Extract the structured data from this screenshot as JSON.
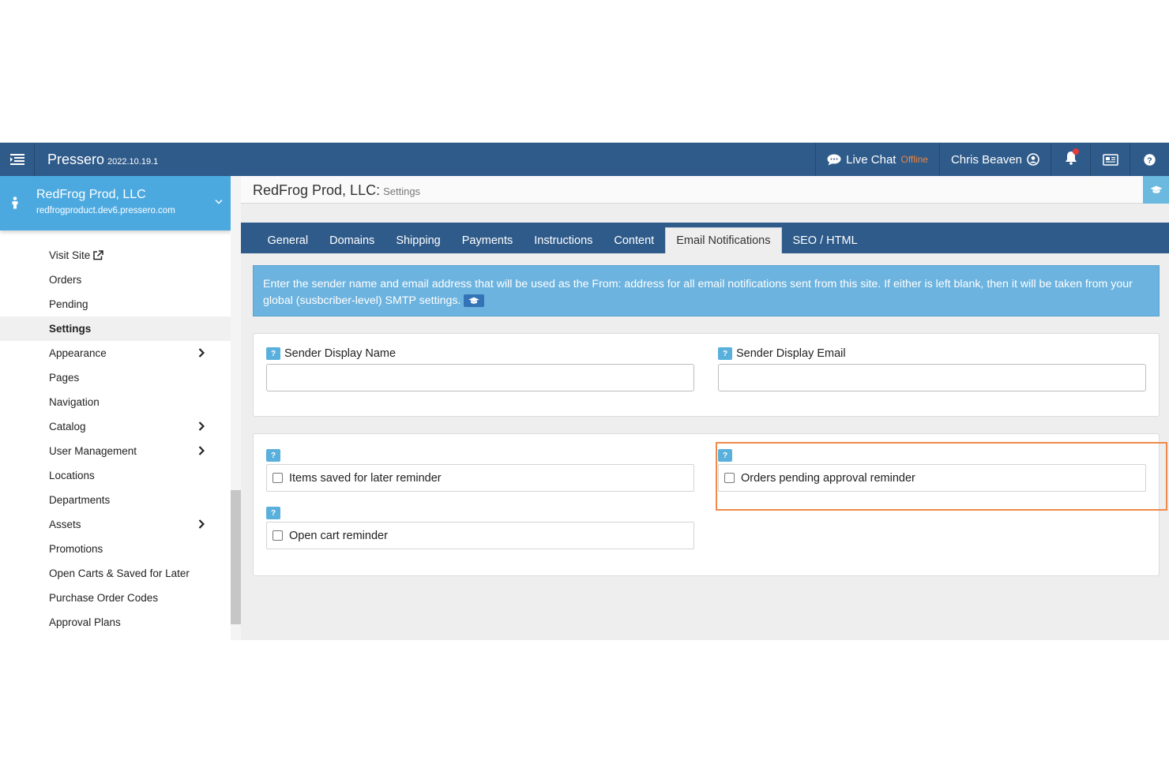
{
  "topbar": {
    "brand": "Pressero",
    "version": "2022.10.19.1",
    "live_chat_label": "Live Chat",
    "live_chat_status": "Offline",
    "user_name": "Chris Beaven"
  },
  "site": {
    "name": "RedFrog Prod, LLC",
    "url": "redfrogproduct.dev6.pressero.com"
  },
  "sidebar": {
    "items": [
      {
        "label": "Visit Site",
        "external": true
      },
      {
        "label": "Orders"
      },
      {
        "label": "Pending"
      },
      {
        "label": "Settings",
        "active": true
      },
      {
        "label": "Appearance",
        "has_children": true
      },
      {
        "label": "Pages"
      },
      {
        "label": "Navigation"
      },
      {
        "label": "Catalog",
        "has_children": true
      },
      {
        "label": "User Management",
        "has_children": true
      },
      {
        "label": "Locations"
      },
      {
        "label": "Departments"
      },
      {
        "label": "Assets",
        "has_children": true
      },
      {
        "label": "Promotions"
      },
      {
        "label": "Open Carts & Saved for Later"
      },
      {
        "label": "Purchase Order Codes"
      },
      {
        "label": "Approval Plans"
      }
    ]
  },
  "page": {
    "title": "RedFrog Prod, LLC:",
    "subtitle": "Settings"
  },
  "tabs": [
    {
      "label": "General"
    },
    {
      "label": "Domains"
    },
    {
      "label": "Shipping"
    },
    {
      "label": "Payments"
    },
    {
      "label": "Instructions"
    },
    {
      "label": "Content"
    },
    {
      "label": "Email Notifications",
      "active": true
    },
    {
      "label": "SEO / HTML"
    }
  ],
  "alert": {
    "text": "Enter the sender name and email address that will be used as the From: address for all email notifications sent from this site. If either is left blank, then it will be taken from your global (susbcriber-level) SMTP settings."
  },
  "sender": {
    "name_label": "Sender Display Name",
    "name_value": "",
    "email_label": "Sender Display Email",
    "email_value": ""
  },
  "reminders": {
    "help_glyph": "?",
    "items_saved_label": "Items saved for later reminder",
    "items_saved_checked": false,
    "orders_pending_label": "Orders pending approval reminder",
    "orders_pending_checked": false,
    "open_cart_label": "Open cart reminder",
    "open_cart_checked": false
  },
  "colors": {
    "topbar": "#2f5b8a",
    "site_card": "#4ba9e0",
    "alert": "#6cb3df",
    "highlight": "#ef8a4a",
    "offline": "#f0843c"
  }
}
